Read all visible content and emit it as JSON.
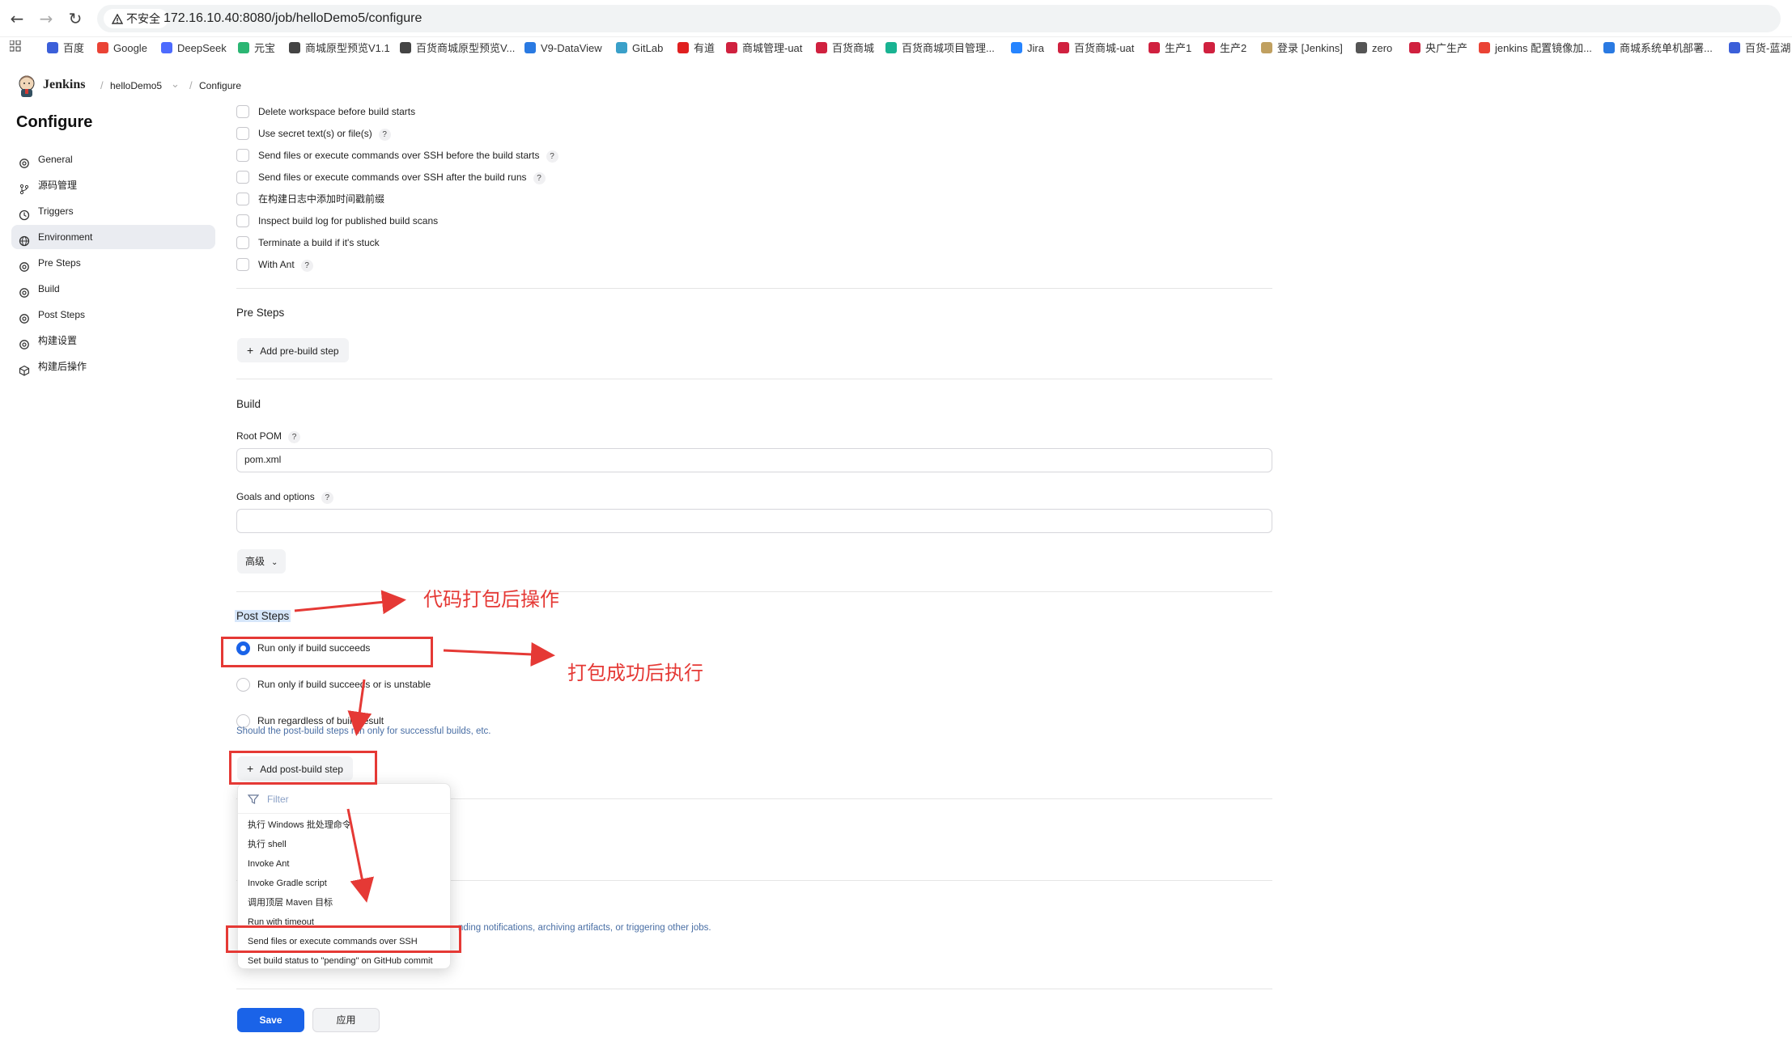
{
  "browser": {
    "security_label": "不安全",
    "url": "172.16.10.40:8080/job/helloDemo5/configure",
    "bookmarks": [
      {
        "label": "百度",
        "color": "#3b5fd9"
      },
      {
        "label": "Google",
        "color": "#ea4335"
      },
      {
        "label": "DeepSeek",
        "color": "#4d6bfe"
      },
      {
        "label": "元宝",
        "color": "#2bb673"
      },
      {
        "label": "商城原型预览V1.1",
        "color": "#444444"
      },
      {
        "label": "百货商城原型预览V...",
        "color": "#444444"
      },
      {
        "label": "V9-DataView",
        "color": "#2a7ae2"
      },
      {
        "label": "GitLab",
        "color": "#3aa0c9"
      },
      {
        "label": "有道",
        "color": "#e02020"
      },
      {
        "label": "商城管理-uat",
        "color": "#d0213f"
      },
      {
        "label": "百货商城",
        "color": "#d0213f"
      },
      {
        "label": "百货商城项目管理...",
        "color": "#19b392"
      },
      {
        "label": "Jira",
        "color": "#2684ff"
      },
      {
        "label": "百货商城-uat",
        "color": "#d0213f"
      },
      {
        "label": "生产1",
        "color": "#d0213f"
      },
      {
        "label": "生产2",
        "color": "#d0213f"
      },
      {
        "label": "登录 [Jenkins]",
        "color": "#c0a060"
      },
      {
        "label": "zero",
        "color": "#555555"
      },
      {
        "label": "央广生产",
        "color": "#d0213f"
      },
      {
        "label": "jenkins 配置镜像加...",
        "color": "#ea4335"
      },
      {
        "label": "商城系统单机部署...",
        "color": "#2a7ae2"
      },
      {
        "label": "百货-蓝湖",
        "color": "#3b5fd9"
      }
    ]
  },
  "header": {
    "brand": "Jenkins",
    "breadcrumb_job": "helloDemo5",
    "breadcrumb_page": "Configure"
  },
  "sidebar": {
    "title": "Configure",
    "items": [
      {
        "label": "General",
        "icon": "gear-icon"
      },
      {
        "label": "源码管理",
        "icon": "branch-icon"
      },
      {
        "label": "Triggers",
        "icon": "clock-icon"
      },
      {
        "label": "Environment",
        "icon": "globe-icon",
        "active": true
      },
      {
        "label": "Pre Steps",
        "icon": "gear-icon"
      },
      {
        "label": "Build",
        "icon": "gear-icon"
      },
      {
        "label": "Post Steps",
        "icon": "gear-icon"
      },
      {
        "label": "构建设置",
        "icon": "gear-icon"
      },
      {
        "label": "构建后操作",
        "icon": "cube-icon"
      }
    ]
  },
  "environment": {
    "options": [
      {
        "label": "Delete workspace before build starts",
        "help": false
      },
      {
        "label": "Use secret text(s) or file(s)",
        "help": true
      },
      {
        "label": "Send files or execute commands over SSH before the build starts",
        "help": true
      },
      {
        "label": "Send files or execute commands over SSH after the build runs",
        "help": true
      },
      {
        "label": "在构建日志中添加时间戳前缀",
        "help": false
      },
      {
        "label": "Inspect build log for published build scans",
        "help": false
      },
      {
        "label": "Terminate a build if it's stuck",
        "help": false
      },
      {
        "label": "With Ant",
        "help": true
      }
    ]
  },
  "pre_steps": {
    "title": "Pre Steps",
    "add_button": "Add pre-build step"
  },
  "build": {
    "title": "Build",
    "root_pom_label": "Root POM",
    "root_pom_value": "pom.xml",
    "goals_label": "Goals and options",
    "goals_value": "",
    "advanced_button": "高级"
  },
  "post_steps": {
    "title": "Post Steps",
    "radios": [
      {
        "label": "Run only if build succeeds",
        "checked": true
      },
      {
        "label": "Run only if build succeeds or is unstable",
        "checked": false
      },
      {
        "label": "Run regardless of build result",
        "checked": false
      }
    ],
    "hint": "Should the post-build steps run only for successful builds, etc.",
    "add_button": "Add post-build step"
  },
  "post_build_hint_partial": "nding notifications, archiving artifacts, or triggering other jobs.",
  "dropdown": {
    "filter_placeholder": "Filter",
    "items": [
      "执行 Windows 批处理命令",
      "执行 shell",
      "Invoke Ant",
      "Invoke Gradle script",
      "调用顶层 Maven 目标",
      "Run with timeout",
      "Send files or execute commands over SSH",
      "Set build status to \"pending\" on GitHub commit"
    ]
  },
  "footer": {
    "save": "Save",
    "apply": "应用"
  },
  "annotations": {
    "post_steps_note": "代码打包后操作",
    "success_note": "打包成功后执行",
    "color": "#e53935"
  }
}
